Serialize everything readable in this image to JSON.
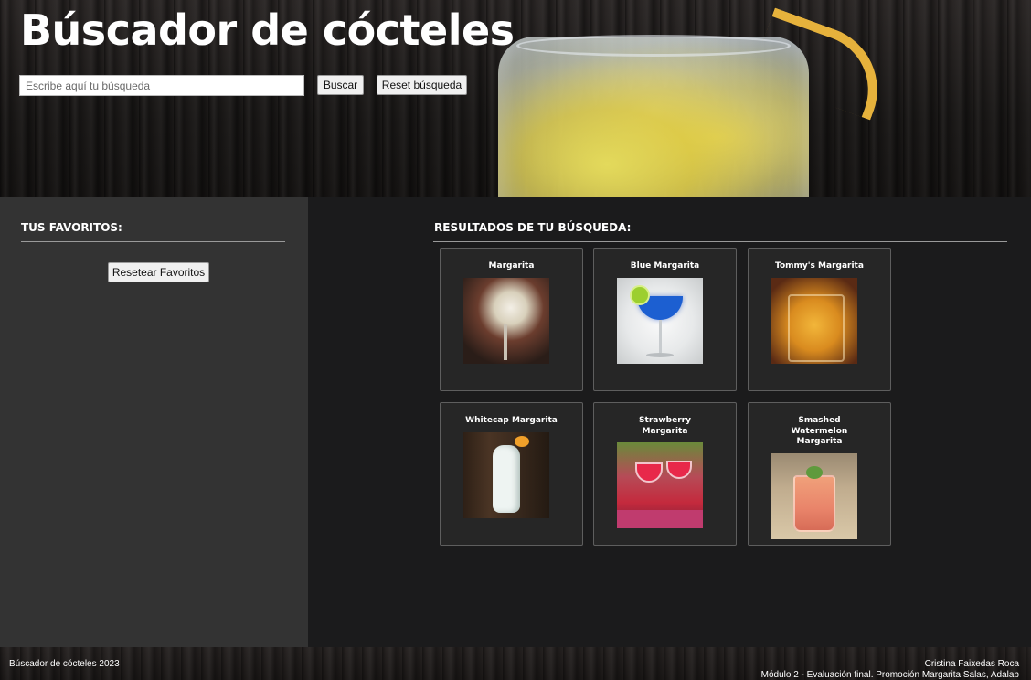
{
  "header": {
    "title": "Búscador de cócteles",
    "search_placeholder": "Escribe aquí tu búsqueda",
    "search_value": "",
    "search_button": "Buscar",
    "reset_search_button": "Reset búsqueda"
  },
  "favorites": {
    "title": "TUS FAVORITOS:",
    "reset_button": "Resetear Favoritos"
  },
  "results": {
    "title": "RESULTADOS DE TU BÚSQUEDA:",
    "items": [
      {
        "name": "Margarita"
      },
      {
        "name": "Blue Margarita"
      },
      {
        "name": "Tommy's Margarita"
      },
      {
        "name": "Whitecap Margarita"
      },
      {
        "name": "Strawberry Margarita"
      },
      {
        "name": "Smashed Watermelon Margarita"
      }
    ]
  },
  "footer": {
    "left": "Búscador de cócteles 2023",
    "author": "Cristina Faixedas Roca",
    "credit": "Módulo 2 - Evaluación final. Promoción Margarita Salas, Adalab"
  },
  "colors": {
    "panel_left": "#333333",
    "panel_main": "#1b1b1c",
    "card_bg": "#262626",
    "card_border": "#5e5e5e"
  }
}
